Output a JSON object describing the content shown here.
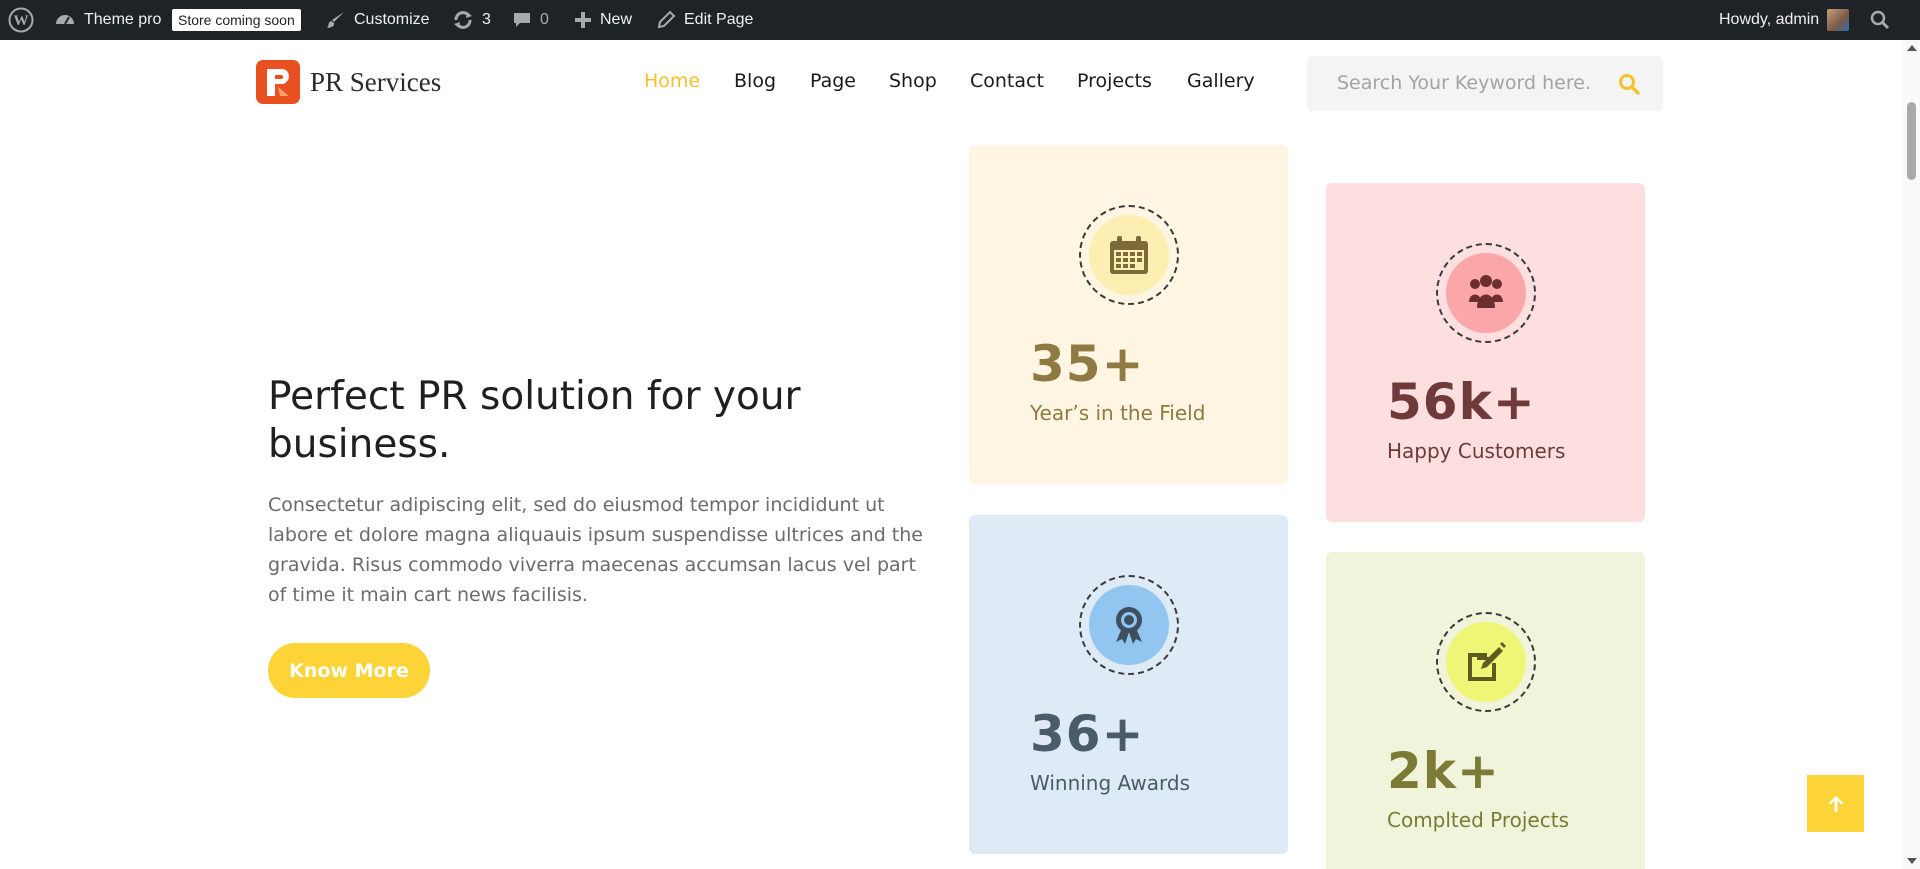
{
  "adminbar": {
    "site_name": "Theme pro",
    "store_badge": "Store coming soon",
    "customize": "Customize",
    "updates_count": "3",
    "comments_count": "0",
    "new_label": "New",
    "edit_page": "Edit Page",
    "howdy": "Howdy, admin"
  },
  "header": {
    "logo_text": "PR Services",
    "nav": [
      "Home",
      "Blog",
      "Page",
      "Shop",
      "Contact",
      "Projects",
      "Gallery"
    ],
    "search_placeholder": "Search Your Keyword here."
  },
  "hero": {
    "title": "Perfect PR solution for your business.",
    "description": "Consectetur adipiscing elit, sed do eiusmod tempor incididunt ut labore et dolore magna aliquauis ipsum suspendisse ultrices and the gravida. Risus commodo viverra maecenas accumsan lacus vel part of time it main cart news facilisis.",
    "button_label": "Know More"
  },
  "stats": [
    {
      "number": "35+",
      "label": "Year’s in the Field",
      "icon": "calendar-icon",
      "bg": "#fef6e2",
      "circle": "#fdeeb2",
      "text_color": "#8f7a44",
      "icon_color": "#7c6a3b"
    },
    {
      "number": "56k+",
      "label": "Happy Customers",
      "icon": "people-icon",
      "bg": "#fddfe0",
      "circle": "#fca7a7",
      "text_color": "#6f3a3a",
      "icon_color": "#6b2f2f"
    },
    {
      "number": "36+",
      "label": "Winning Awards",
      "icon": "award-icon",
      "bg": "#deebf6",
      "circle": "#92c5ef",
      "text_color": "#4a5b6a",
      "icon_color": "#3e4f60"
    },
    {
      "number": "2k+",
      "label": "Complted Projects",
      "icon": "edit-icon",
      "bg": "#f0f4da",
      "circle": "#eff575",
      "text_color": "#7b7a36",
      "icon_color": "#5c5c22"
    }
  ],
  "colors": {
    "accent": "#fdd437",
    "nav_active": "#f2c32e",
    "adminbar_bg": "#1d2327"
  }
}
